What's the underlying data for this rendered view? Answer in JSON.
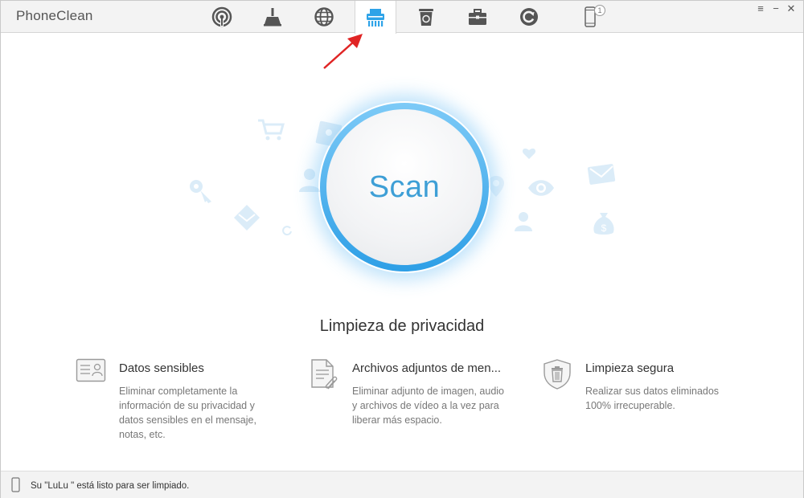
{
  "app": {
    "title": "PhoneClean"
  },
  "tabs": [
    {
      "id": "quick-clean",
      "icon": "airdrop-icon",
      "active": false
    },
    {
      "id": "internet-clean",
      "icon": "broom-icon",
      "active": false
    },
    {
      "id": "web-clean",
      "icon": "globe-icon",
      "active": false
    },
    {
      "id": "privacy-clean",
      "icon": "shredder-icon",
      "active": true
    },
    {
      "id": "silent-clean",
      "icon": "recycle-bin-icon",
      "active": false
    },
    {
      "id": "toolbox",
      "icon": "toolbox-icon",
      "active": false
    },
    {
      "id": "backup",
      "icon": "restore-icon",
      "active": false
    },
    {
      "id": "device",
      "icon": "phone-icon",
      "active": false,
      "badge": "1"
    }
  ],
  "window_controls": {
    "menu": "≡",
    "minimize": "−",
    "close": "✕"
  },
  "scan": {
    "label": "Scan"
  },
  "main": {
    "heading": "Limpieza de privacidad",
    "features": [
      {
        "icon": "id-card-icon",
        "title": "Datos sensibles",
        "description": "Eliminar completamente la información de su privacidad y datos sensibles en el mensaje, notas, etc."
      },
      {
        "icon": "attachment-document-icon",
        "title": "Archivos adjuntos de men...",
        "description": "Eliminar adjunto de imagen, audio y archivos de vídeo a la vez para liberar más espacio."
      },
      {
        "icon": "shield-trash-icon",
        "title": "Limpieza segura",
        "description": "Realizar sus datos eliminados 100% irrecuperable."
      }
    ]
  },
  "status": {
    "text": "Su \"LuLu \" está listo para ser limpiado."
  },
  "colors": {
    "accent": "#3e9fd6",
    "ring": "#2e9fe6",
    "arrow": "#e02424",
    "faint_icon": "#dfeef9"
  }
}
